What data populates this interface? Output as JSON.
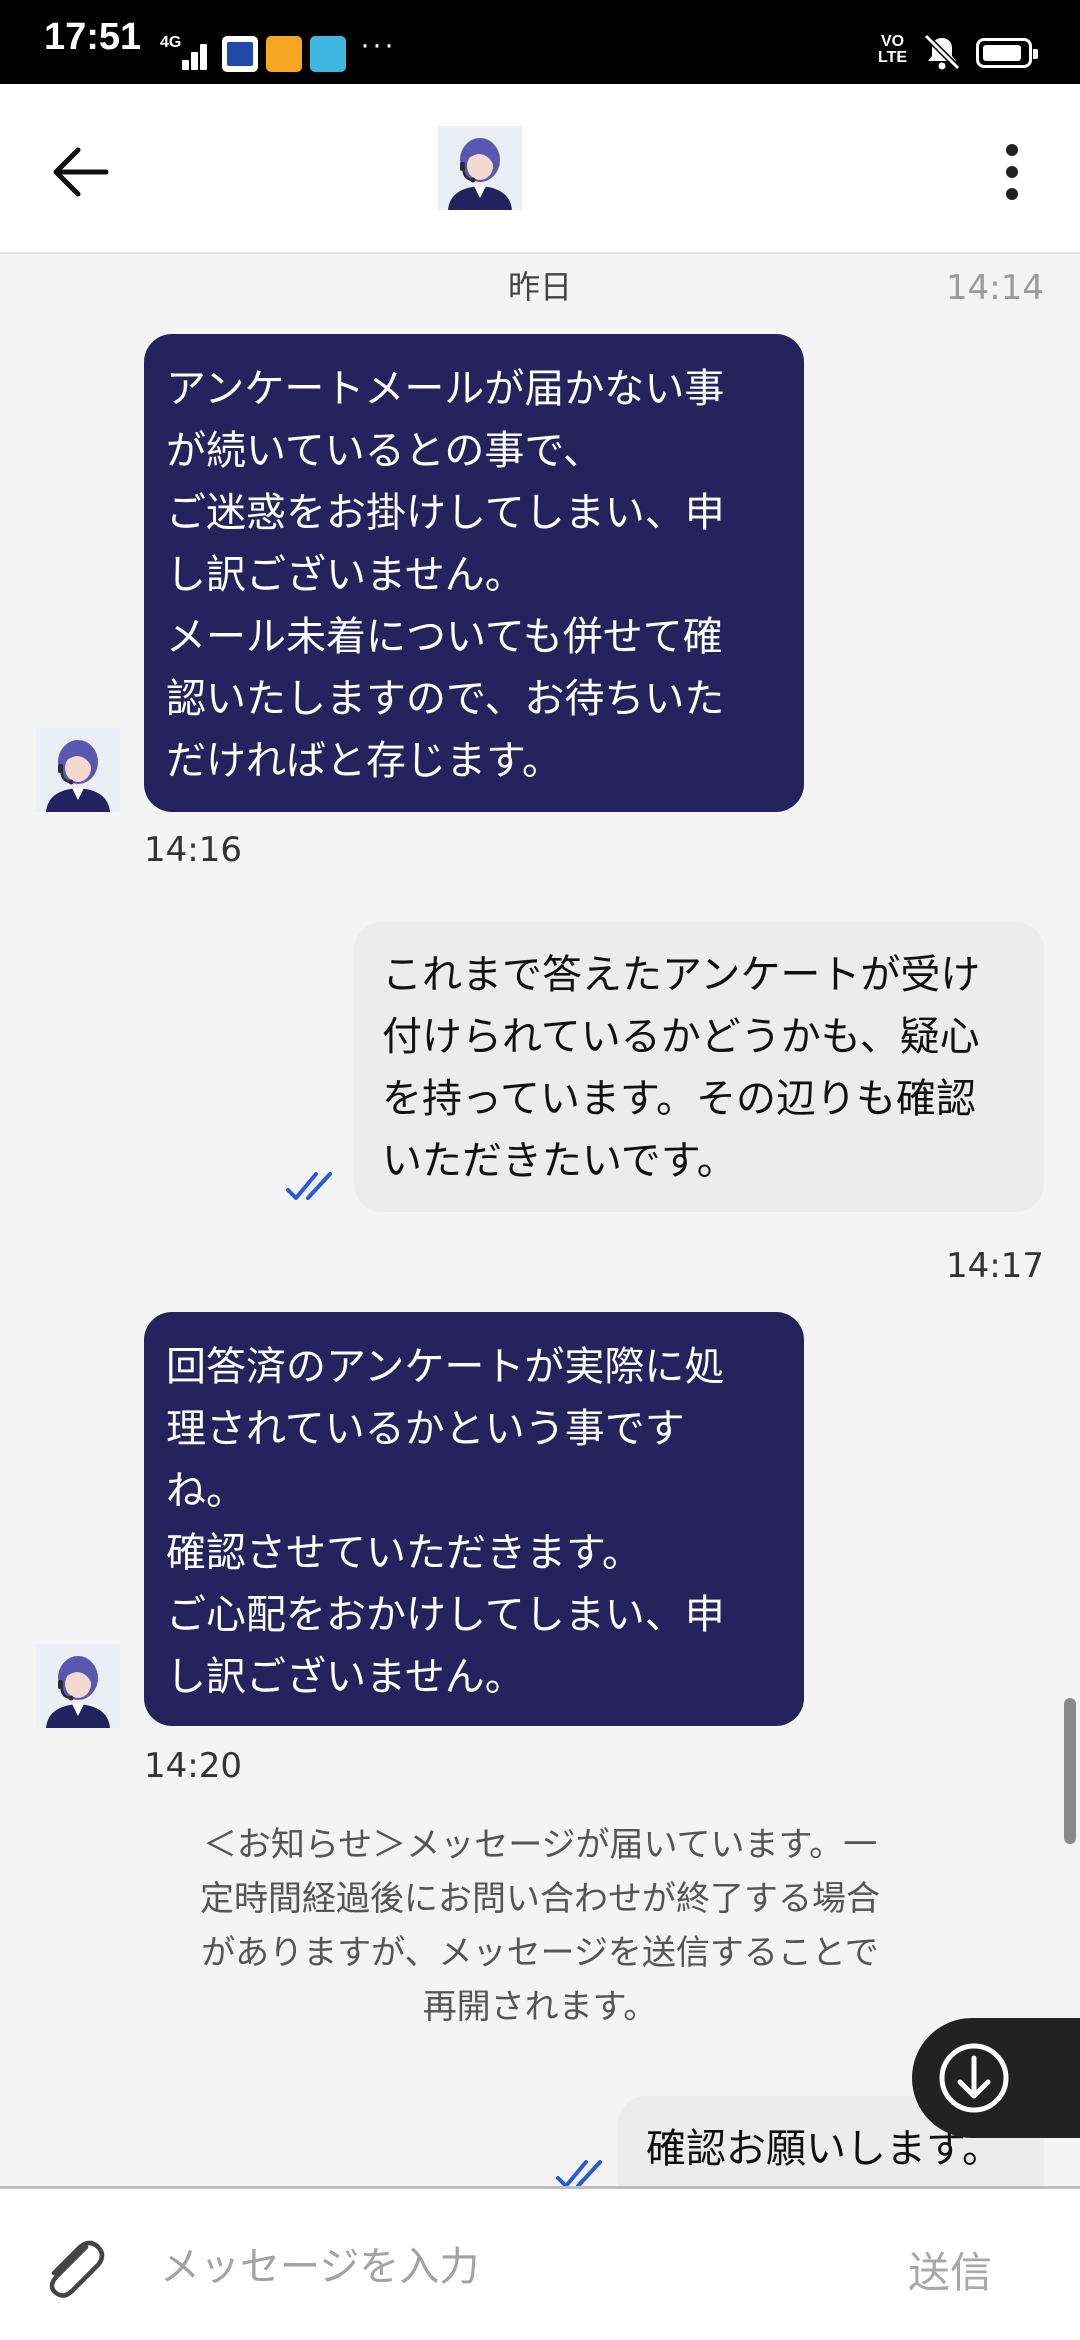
{
  "status_bar": {
    "time": "17:51",
    "network": "4G",
    "volte": [
      "VO",
      "LTE"
    ],
    "overflow": "···",
    "icons": [
      "signal-icon",
      "news-app-icon",
      "notification-app-icon",
      "photos-app-icon",
      "silent-bell-icon",
      "battery-icon"
    ]
  },
  "header": {
    "back_icon": "arrow-left-icon",
    "avatar_icon": "support-agent-avatar",
    "more_icon": "more-vertical-icon"
  },
  "chat": {
    "date_separator": "昨日",
    "ghost_time": "14:14",
    "messages": [
      {
        "direction": "incoming",
        "lines": [
          "アンケートメールが届かない事",
          "が続いているとの事で、",
          "ご迷惑をお掛けしてしまい、申",
          "し訳ございません。",
          "メール未着についても併せて確",
          "認いたしますので、お待ちいた",
          "だければと存じます。"
        ],
        "time": "14:16"
      },
      {
        "direction": "outgoing",
        "lines": [
          "これまで答えたアンケートが受け",
          "付けられているかどうかも、疑心",
          "を持っています。その辺りも確認",
          "いただきたいです。"
        ],
        "time": "14:17",
        "read": true
      },
      {
        "direction": "incoming",
        "lines": [
          "回答済のアンケートが実際に処",
          "理されているかという事です",
          "ね。",
          "確認させていただきます。",
          "ご心配をおかけしてしまい、申",
          "し訳ございません。"
        ],
        "time": "14:20"
      },
      {
        "direction": "outgoing",
        "lines": [
          "確認お願いします。"
        ],
        "read": true
      }
    ],
    "notice_lines": [
      "＜お知らせ＞メッセージが届いています。一",
      "定時間経過後にお問い合わせが終了する場合",
      "がありますが、メッセージを送信することで",
      "再開されます。"
    ],
    "scroll_button_icon": "arrow-down-circle-icon"
  },
  "composer": {
    "attach_icon": "paperclip-icon",
    "placeholder": "メッセージを入力",
    "value": "",
    "send_label": "送信"
  },
  "colors": {
    "incoming_bubble": "#24235e",
    "outgoing_bubble": "#ececec",
    "read_check": "#2a5bd7"
  }
}
